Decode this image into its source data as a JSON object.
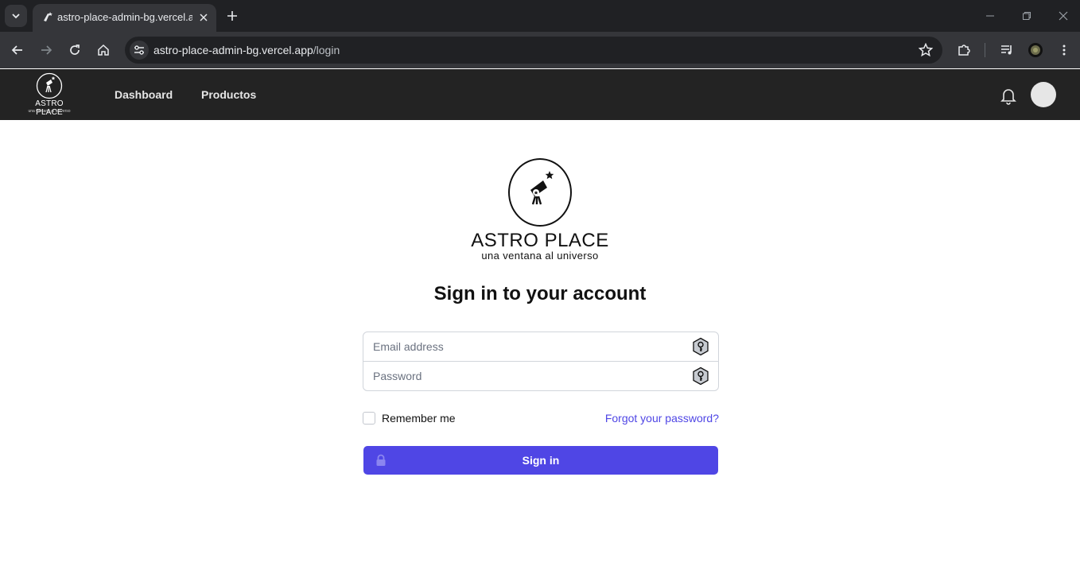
{
  "browser": {
    "tab_title": "astro-place-admin-bg.vercel.app/login",
    "url_host": "astro-place-admin-bg.vercel.app",
    "url_path": "/login"
  },
  "header": {
    "logo_title": "ASTRO PLACE",
    "logo_subtitle": "una ventana al universo",
    "nav": [
      {
        "label": "Dashboard"
      },
      {
        "label": "Productos"
      }
    ]
  },
  "login": {
    "brand_title": "ASTRO PLACE",
    "brand_subtitle": "una ventana al universo",
    "heading": "Sign in to your account",
    "email_placeholder": "Email address",
    "password_placeholder": "Password",
    "remember_label": "Remember me",
    "forgot_label": "Forgot your password?",
    "submit_label": "Sign in"
  },
  "colors": {
    "accent": "#4f46e5",
    "header_bg": "#232323"
  }
}
